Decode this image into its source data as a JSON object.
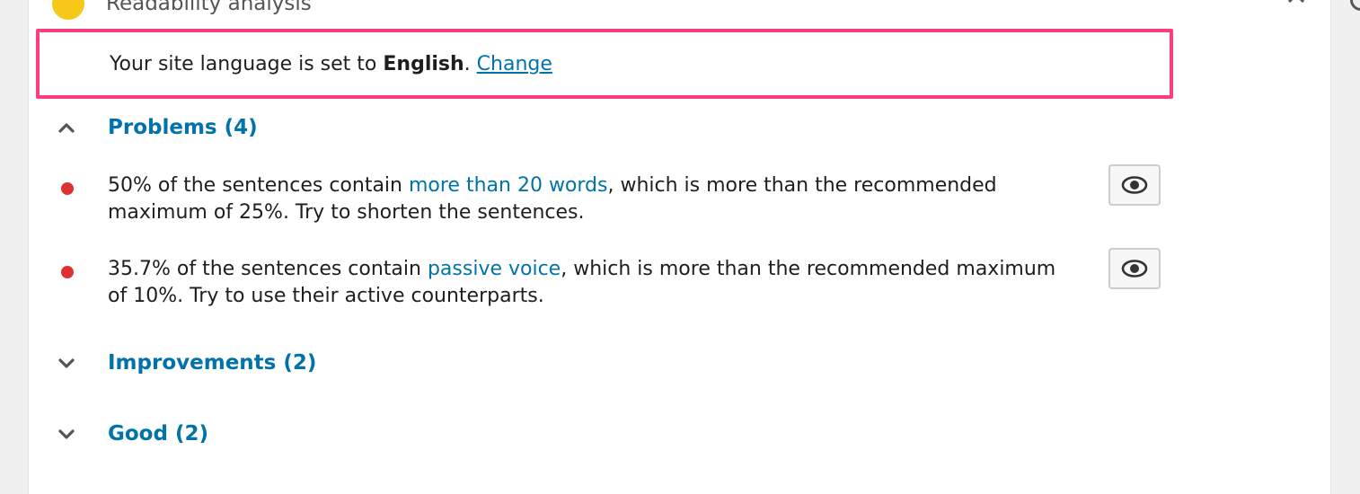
{
  "header": {
    "title": "Readability analysis",
    "status_color": "#f5c819"
  },
  "language": {
    "prefix": "Your site language is set to ",
    "language": "English",
    "suffix": ". ",
    "change_label": "Change"
  },
  "sections": {
    "problems": {
      "label": "Problems (4)",
      "expanded": true
    },
    "improvements": {
      "label": "Improvements (2)",
      "expanded": false
    },
    "good": {
      "label": "Good (2)",
      "expanded": false
    }
  },
  "issues": [
    {
      "before": "50% of the sentences contain ",
      "link": "more than 20 words",
      "after": ", which is more than the recommended maximum of 25%. Try to shorten the sentences.",
      "status_color": "#dc3232",
      "icon": "eye-icon"
    },
    {
      "before": "35.7% of the sentences contain ",
      "link": "passive voice",
      "after": ", which is more than the recommended maximum of 10%. Try to use their active counterparts.",
      "status_color": "#dc3232",
      "icon": "eye-icon"
    }
  ],
  "colors": {
    "accent": "#0073aa",
    "highlight_border": "#ff3d7a",
    "problem": "#dc3232"
  }
}
